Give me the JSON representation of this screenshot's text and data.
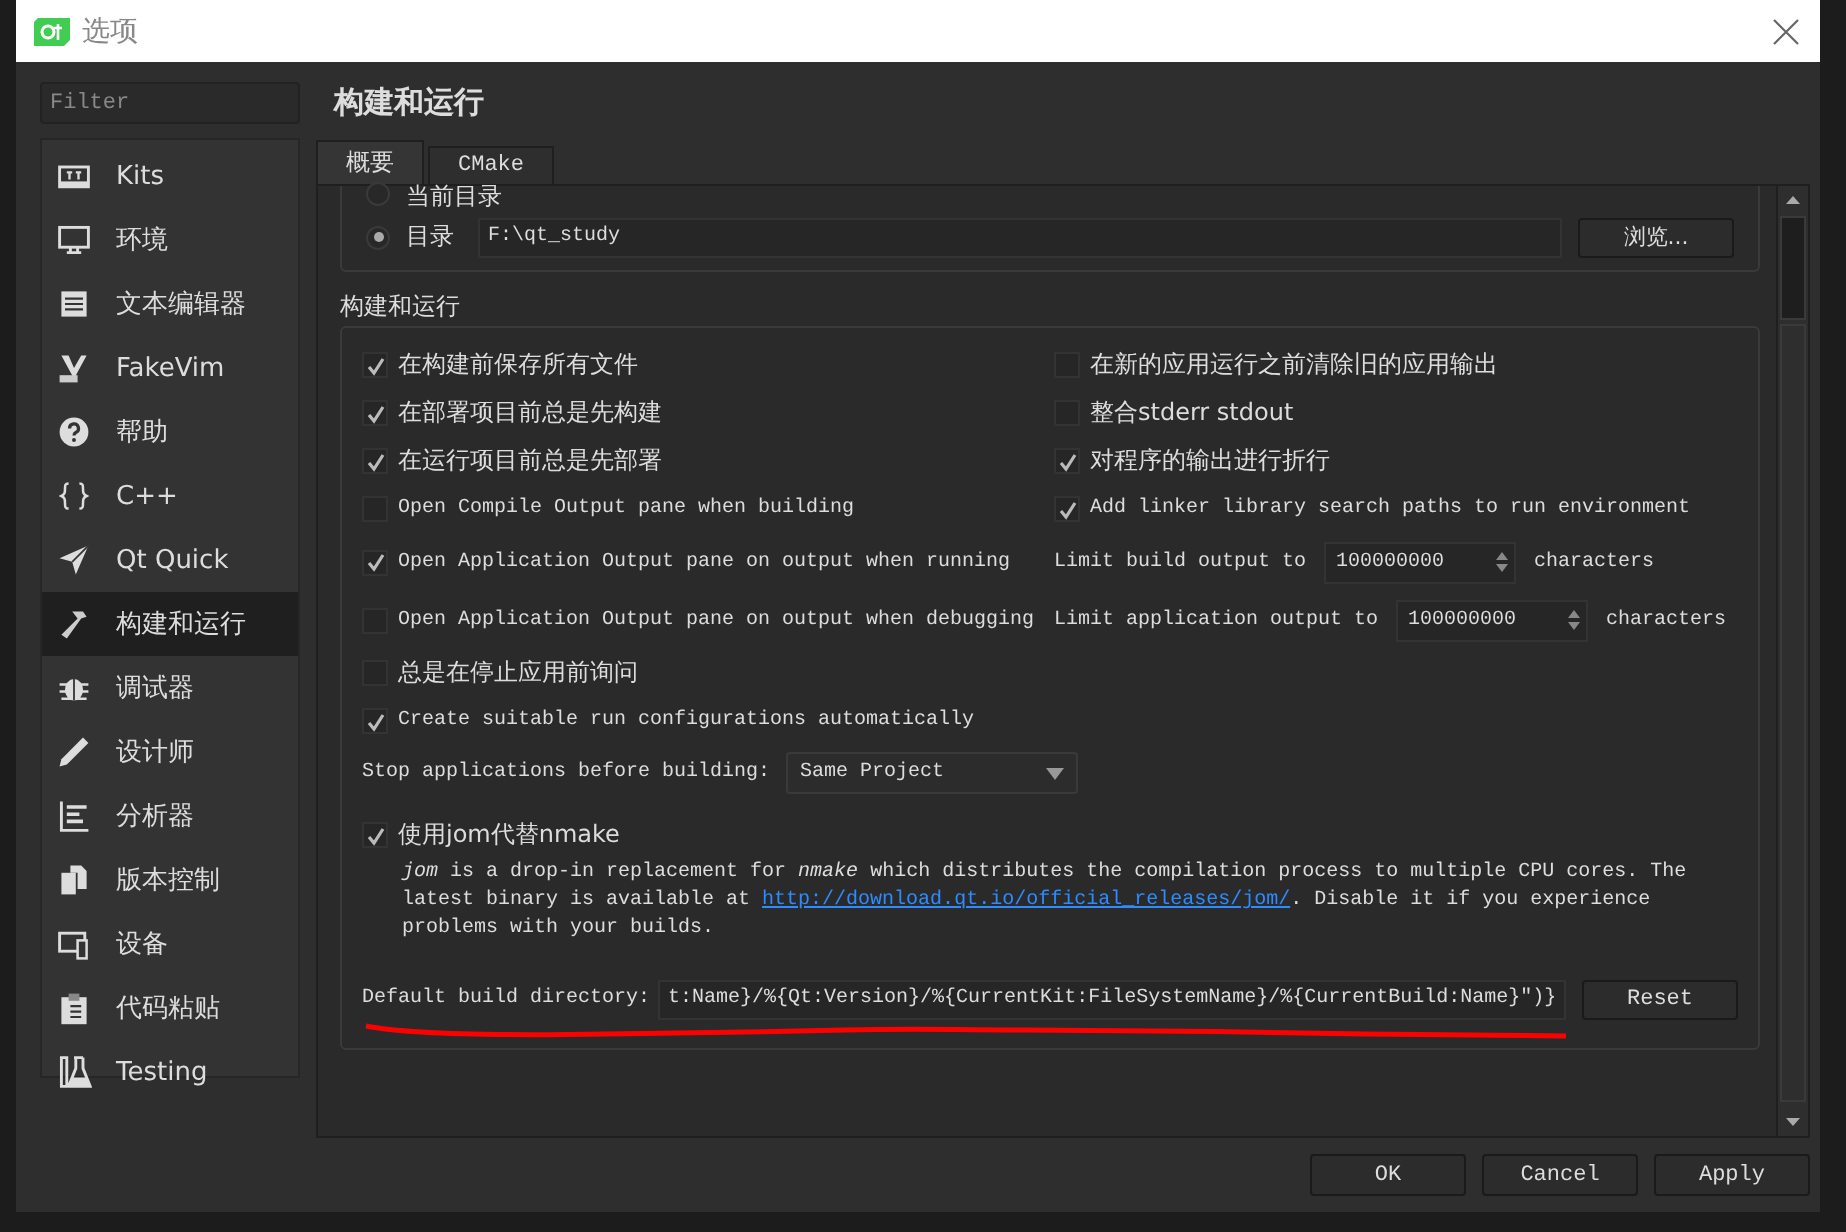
{
  "window": {
    "title": "选项"
  },
  "filter": {
    "placeholder": "Filter"
  },
  "sidebar": {
    "items": [
      {
        "label": "Kits",
        "selected": false
      },
      {
        "label": "环境",
        "selected": false
      },
      {
        "label": "文本编辑器",
        "selected": false
      },
      {
        "label": "FakeVim",
        "selected": false
      },
      {
        "label": "帮助",
        "selected": false
      },
      {
        "label": "C++",
        "selected": false
      },
      {
        "label": "Qt Quick",
        "selected": false
      },
      {
        "label": "构建和运行",
        "selected": true
      },
      {
        "label": "调试器",
        "selected": false
      },
      {
        "label": "设计师",
        "selected": false
      },
      {
        "label": "分析器",
        "selected": false
      },
      {
        "label": "版本控制",
        "selected": false
      },
      {
        "label": "设备",
        "selected": false
      },
      {
        "label": "代码粘贴",
        "selected": false
      },
      {
        "label": "Testing",
        "selected": false
      }
    ]
  },
  "page": {
    "heading": "构建和运行",
    "tabs": [
      {
        "label": "概要",
        "selected": true
      },
      {
        "label": "CMake",
        "selected": false
      }
    ],
    "directory": {
      "options": [
        {
          "label": "当前目录",
          "selected": false
        },
        {
          "label": "目录",
          "selected": true
        }
      ],
      "path": "F:\\qt_study",
      "browse": "浏览..."
    },
    "section_title": "构建和运行",
    "rows": [
      [
        {
          "kind": "checkbox",
          "label": "在构建前保存所有文件",
          "checked": true
        },
        {
          "kind": "checkbox",
          "label": "在新的应用运行之前清除旧的应用输出",
          "checked": false
        }
      ],
      [
        {
          "kind": "checkbox",
          "label": "在部署项目前总是先构建",
          "checked": true
        },
        {
          "kind": "checkbox",
          "label": "整合stderr stdout",
          "checked": false
        }
      ],
      [
        {
          "kind": "checkbox",
          "label": "在运行项目前总是先部署",
          "checked": true
        },
        {
          "kind": "checkbox",
          "label": "对程序的输出进行折行",
          "checked": true
        }
      ],
      [
        {
          "kind": "checkbox",
          "label": "Open Compile Output pane when building",
          "checked": false
        },
        {
          "kind": "checkbox",
          "label": "Add linker library search paths to run environment",
          "checked": true
        }
      ],
      [
        {
          "kind": "checkbox",
          "label": "Open Application Output pane on output when running",
          "checked": true
        },
        {
          "kind": "limit",
          "label": "Limit build output to",
          "value": "100000000",
          "unit": "characters"
        }
      ],
      [
        {
          "kind": "checkbox",
          "label": "Open Application Output pane on output when debugging",
          "checked": false
        },
        {
          "kind": "limit",
          "label": "Limit application output to",
          "value": "100000000",
          "unit": "characters"
        }
      ],
      [
        {
          "kind": "checkbox",
          "label": "总是在停止应用前询问",
          "checked": false
        }
      ],
      [
        {
          "kind": "checkbox",
          "label": "Create suitable run configurations automatically",
          "checked": true
        }
      ]
    ],
    "stop": {
      "label": "Stop applications before building:",
      "value": "Same Project"
    },
    "jom": {
      "label": "使用jom代替nmake",
      "checked": true,
      "description_before": "*jom* is a drop-in replacement for *nmake* which distributes the compilation process to multiple CPU cores. The latest binary is available at",
      "link": "http://download.qt.io/official_releases/jom/",
      "description_after": ". Disable it if you experience problems with your builds."
    },
    "build_dir": {
      "label": "Default build directory:",
      "value": "t:Name}/%{Qt:Version}/%{CurrentKit:FileSystemName}/%{CurrentBuild:Name}\")}",
      "reset": "Reset"
    }
  },
  "buttons": [
    "OK",
    "Cancel",
    "Apply"
  ]
}
